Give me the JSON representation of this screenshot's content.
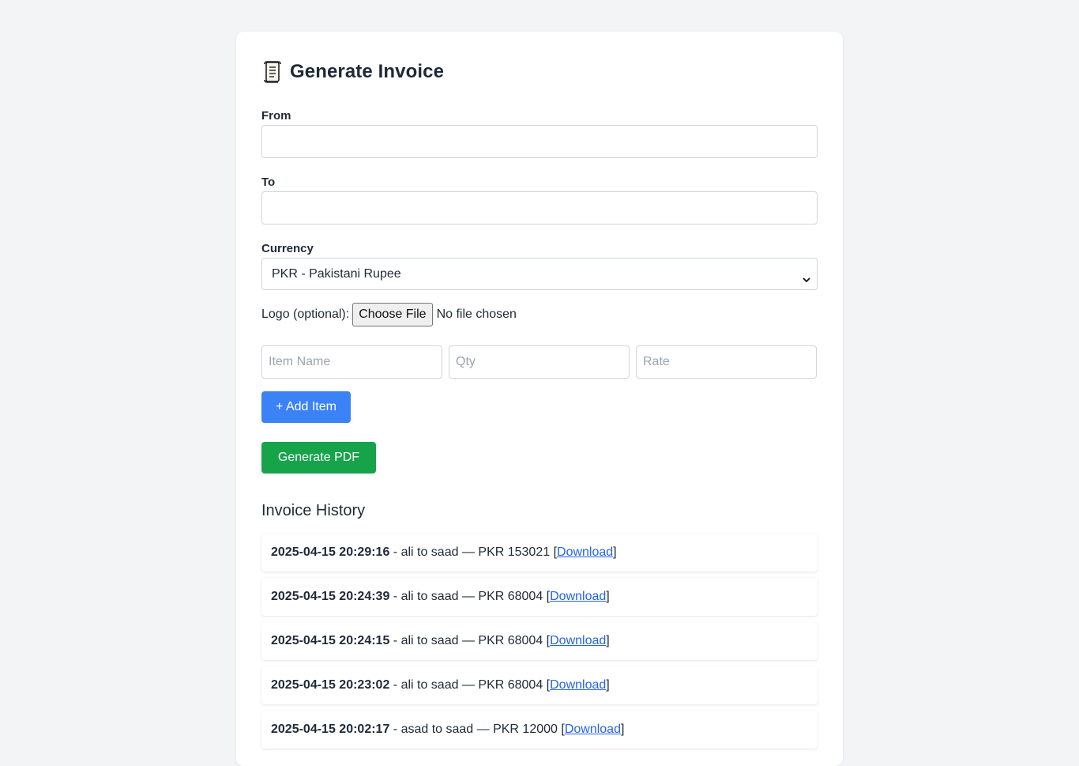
{
  "page": {
    "title": "Generate Invoice"
  },
  "form": {
    "from_label": "From",
    "from_value": "",
    "to_label": "To",
    "to_value": "",
    "currency_label": "Currency",
    "currency_selected": "PKR - Pakistani Rupee",
    "logo_label": "Logo (optional):",
    "choose_file_label": "Choose File",
    "no_file_text": "No file chosen",
    "item_name_placeholder": "Item Name",
    "qty_placeholder": "Qty",
    "rate_placeholder": "Rate",
    "add_item_label": "+ Add Item",
    "generate_pdf_label": "Generate PDF"
  },
  "history": {
    "heading": "Invoice History",
    "items": [
      {
        "timestamp": "2025-04-15 20:29:16",
        "summary": " - ali to saad — PKR 153021 [",
        "link": "Download",
        "close": "]"
      },
      {
        "timestamp": "2025-04-15 20:24:39",
        "summary": " - ali to saad — PKR 68004 [",
        "link": "Download",
        "close": "]"
      },
      {
        "timestamp": "2025-04-15 20:24:15",
        "summary": " - ali to saad — PKR 68004 [",
        "link": "Download",
        "close": "]"
      },
      {
        "timestamp": "2025-04-15 20:23:02",
        "summary": " - ali to saad — PKR 68004 [",
        "link": "Download",
        "close": "]"
      },
      {
        "timestamp": "2025-04-15 20:02:17",
        "summary": " - asad to saad — PKR 12000 [",
        "link": "Download",
        "close": "]"
      }
    ]
  },
  "colors": {
    "page_bg": "#f3f4f6",
    "card_bg": "#ffffff",
    "primary_blue": "#3b82f6",
    "success_green": "#16a34a",
    "link_blue": "#2563eb"
  },
  "icons": {
    "title_icon": "scroll-icon",
    "select_icon": "chevron-down-icon"
  }
}
